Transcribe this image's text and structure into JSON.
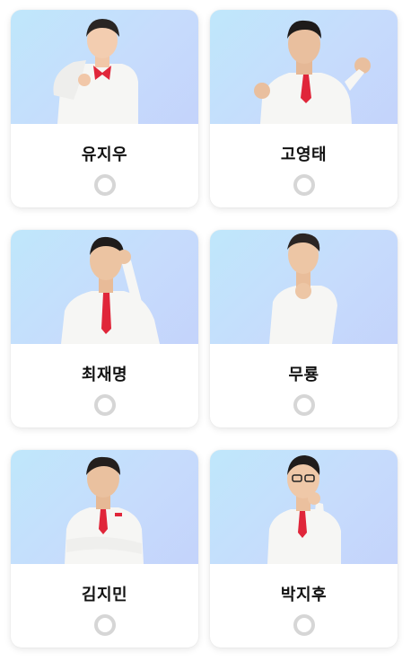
{
  "candidates": [
    {
      "name": "유지우",
      "selected": false,
      "pose": "child"
    },
    {
      "name": "고영태",
      "selected": false,
      "pose": "thumbs"
    },
    {
      "name": "최재명",
      "selected": false,
      "pose": "salute"
    },
    {
      "name": "무룡",
      "selected": false,
      "pose": "point"
    },
    {
      "name": "김지민",
      "selected": false,
      "pose": "arms-crossed"
    },
    {
      "name": "박지후",
      "selected": false,
      "pose": "chin"
    }
  ],
  "colors": {
    "photo_bg_start": "#bfe7fb",
    "photo_bg_end": "#c4d3fb",
    "radio_border": "#d6d6d6",
    "suit": "#f7f7f5",
    "tie": "#e0263a"
  }
}
